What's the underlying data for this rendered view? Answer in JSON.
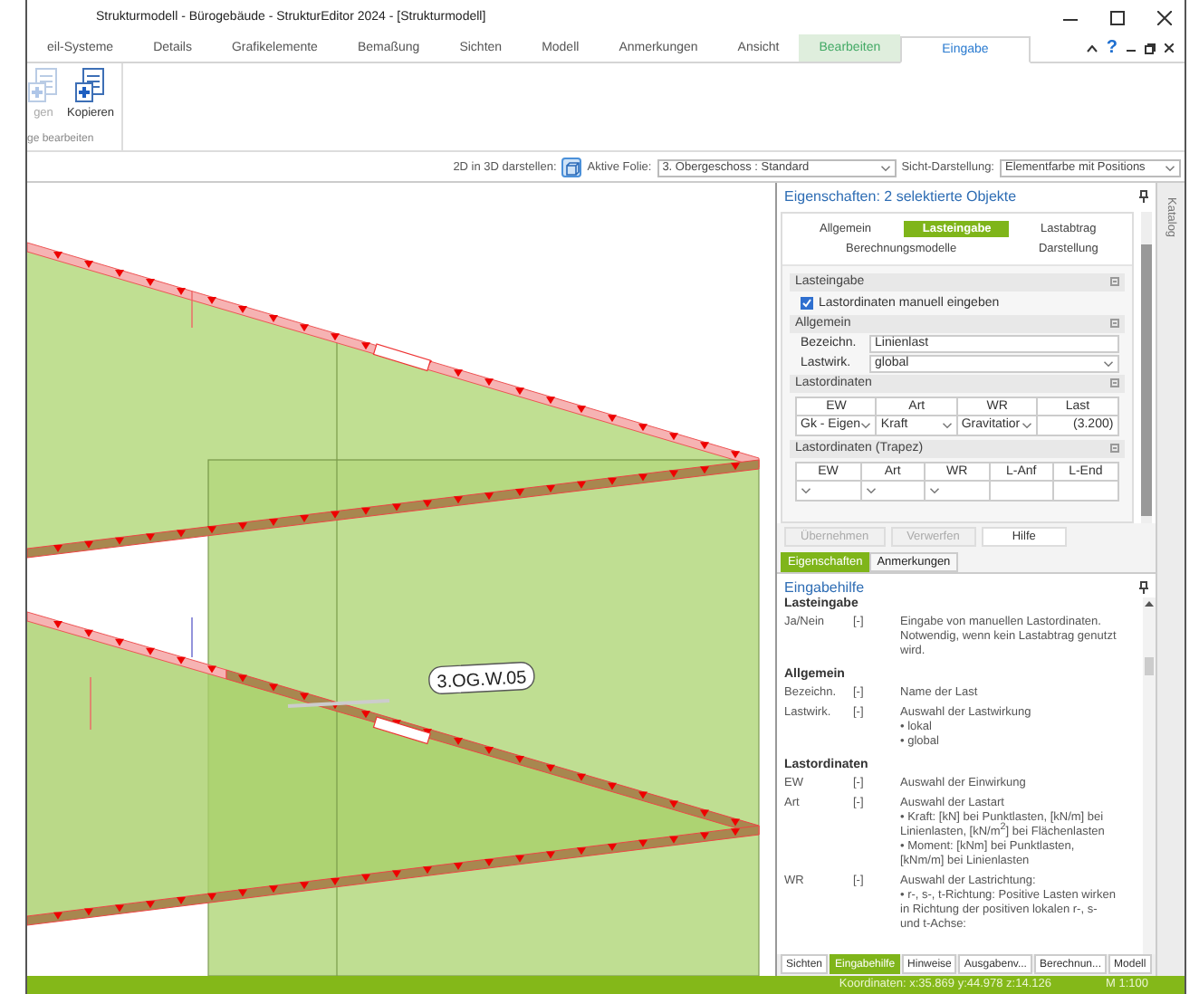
{
  "window": {
    "title": "Strukturmodell - Bürogebäude - StrukturEditor 2024 - [Strukturmodell]"
  },
  "ribbon_tabs": [
    {
      "label": "eil-Systeme",
      "selected": false,
      "kind": "normal"
    },
    {
      "label": "Details",
      "selected": false,
      "kind": "normal"
    },
    {
      "label": "Grafikelemente",
      "selected": false,
      "kind": "normal"
    },
    {
      "label": "Bemaßung",
      "selected": false,
      "kind": "normal"
    },
    {
      "label": "Sichten",
      "selected": false,
      "kind": "normal"
    },
    {
      "label": "Modell",
      "selected": false,
      "kind": "normal"
    },
    {
      "label": "Anmerkungen",
      "selected": false,
      "kind": "normal"
    },
    {
      "label": "Ansicht",
      "selected": false,
      "kind": "normal"
    },
    {
      "label": "Bearbeiten",
      "selected": false,
      "kind": "contextual"
    },
    {
      "label": "Eingabe",
      "selected": true,
      "kind": "normal"
    }
  ],
  "help_glyph": "?",
  "ribbon": {
    "buttons": [
      {
        "label": "gen",
        "disabled": true
      },
      {
        "label": "Kopieren",
        "disabled": false
      }
    ],
    "group_label": "ge bearbeiten"
  },
  "toolbar": {
    "view_2d_label": "2D in 3D darstellen:",
    "view_2d_on": true,
    "layer_label": "Aktive Folie:",
    "layer_value": "3. Obergeschoss : Standard",
    "display_label": "Sicht-Darstellung:",
    "display_value": "Elementfarbe mit Positions"
  },
  "drawing": {
    "wall_label": "3.OG.W.05"
  },
  "properties": {
    "title": "Eigenschaften: 2 selektierte Objekte",
    "tabs": [
      {
        "label": "Allgemein",
        "selected": false
      },
      {
        "label": "Lasteingabe",
        "selected": true
      },
      {
        "label": "Lastabtrag",
        "selected": false
      },
      {
        "label": "Berechnungsmodelle",
        "selected": false
      },
      {
        "label": "Darstellung",
        "selected": false
      }
    ],
    "load_input": {
      "heading": "Lasteingabe",
      "checkbox_label": "Lastordinaten manuell eingeben",
      "checked": true
    },
    "general": {
      "heading": "Allgemein",
      "fields": [
        {
          "label": "Bezeichn.",
          "value": "Linienlast",
          "kind": "text"
        },
        {
          "label": "Lastwirk.",
          "value": "global",
          "kind": "dropdown"
        }
      ]
    },
    "ordinates": {
      "heading": "Lastordinaten",
      "columns": [
        "EW",
        "Art",
        "WR",
        "Last"
      ],
      "row": [
        {
          "value": "Gk - Eigen",
          "kind": "dropdown"
        },
        {
          "value": "Kraft",
          "kind": "dropdown"
        },
        {
          "value": "Gravitatior",
          "kind": "dropdown"
        },
        {
          "value": "(3.200)",
          "kind": "text"
        }
      ]
    },
    "trapezoid": {
      "heading": "Lastordinaten (Trapez)",
      "columns": [
        "EW",
        "Art",
        "WR",
        "L-Anf",
        "L-End"
      ],
      "row": [
        {
          "kind": "dropdown"
        },
        {
          "kind": "dropdown"
        },
        {
          "kind": "dropdown"
        },
        {
          "kind": "text"
        },
        {
          "kind": "text"
        }
      ]
    },
    "buttons": [
      {
        "label": "Übernehmen",
        "disabled": true
      },
      {
        "label": "Verwerfen",
        "disabled": true
      },
      {
        "label": "Hilfe",
        "disabled": false
      }
    ]
  },
  "panel_tabs": [
    {
      "label": "Eigenschaften",
      "selected": true
    },
    {
      "label": "Anmerkungen",
      "selected": false
    }
  ],
  "side_tab": "Katalog",
  "help": {
    "title": "Eingabehilfe",
    "sections": [
      {
        "heading": "Lasteingabe",
        "entries": [
          {
            "term": "Ja/Nein",
            "unit": "[-]",
            "lines": [
              "Eingabe von manuellen Lastordinaten.",
              "Notwendig, wenn kein Lastabtrag genutzt",
              "wird."
            ]
          }
        ]
      },
      {
        "heading": "Allgemein",
        "entries": [
          {
            "term": "Bezeichn.",
            "unit": "[-]",
            "lines": [
              "Name der Last"
            ]
          },
          {
            "term": "Lastwirk.",
            "unit": "[-]",
            "lines": [
              "Auswahl der Lastwirkung",
              "• lokal",
              "• global"
            ]
          }
        ]
      },
      {
        "heading": "Lastordinaten",
        "entries": [
          {
            "term": "EW",
            "unit": "[-]",
            "lines": [
              "Auswahl der Einwirkung"
            ]
          },
          {
            "term": "Art",
            "unit": "[-]",
            "lines": [
              "Auswahl der Lastart",
              "• Kraft: [kN] bei Punktlasten, [kN/m] bei",
              "Linienlasten, [kN/m$^{2}$] bei Flächenlasten",
              "• Moment: [kNm] bei Punktlasten,",
              "[kNm/m] bei Linienlasten"
            ]
          },
          {
            "term": "WR",
            "unit": "[-]",
            "lines": [
              "Auswahl der Lastrichtung:",
              "• r-, s-, t-Richtung: Positive Lasten wirken",
              "in Richtung der positiven lokalen r-, s-",
              "und t-Achse:"
            ]
          }
        ]
      }
    ]
  },
  "bottom_tabs": [
    {
      "label": "Sichten",
      "selected": false
    },
    {
      "label": "Eingabehilfe",
      "selected": true
    },
    {
      "label": "Hinweise",
      "selected": false
    },
    {
      "label": "Ausgabenv...",
      "selected": false
    },
    {
      "label": "Berechnun...",
      "selected": false
    },
    {
      "label": "Modell",
      "selected": false
    }
  ],
  "status_bar": {
    "coordinates": "Koordinaten: x:35.869 y:44.978 z:14.126",
    "scale": "M 1:100"
  }
}
